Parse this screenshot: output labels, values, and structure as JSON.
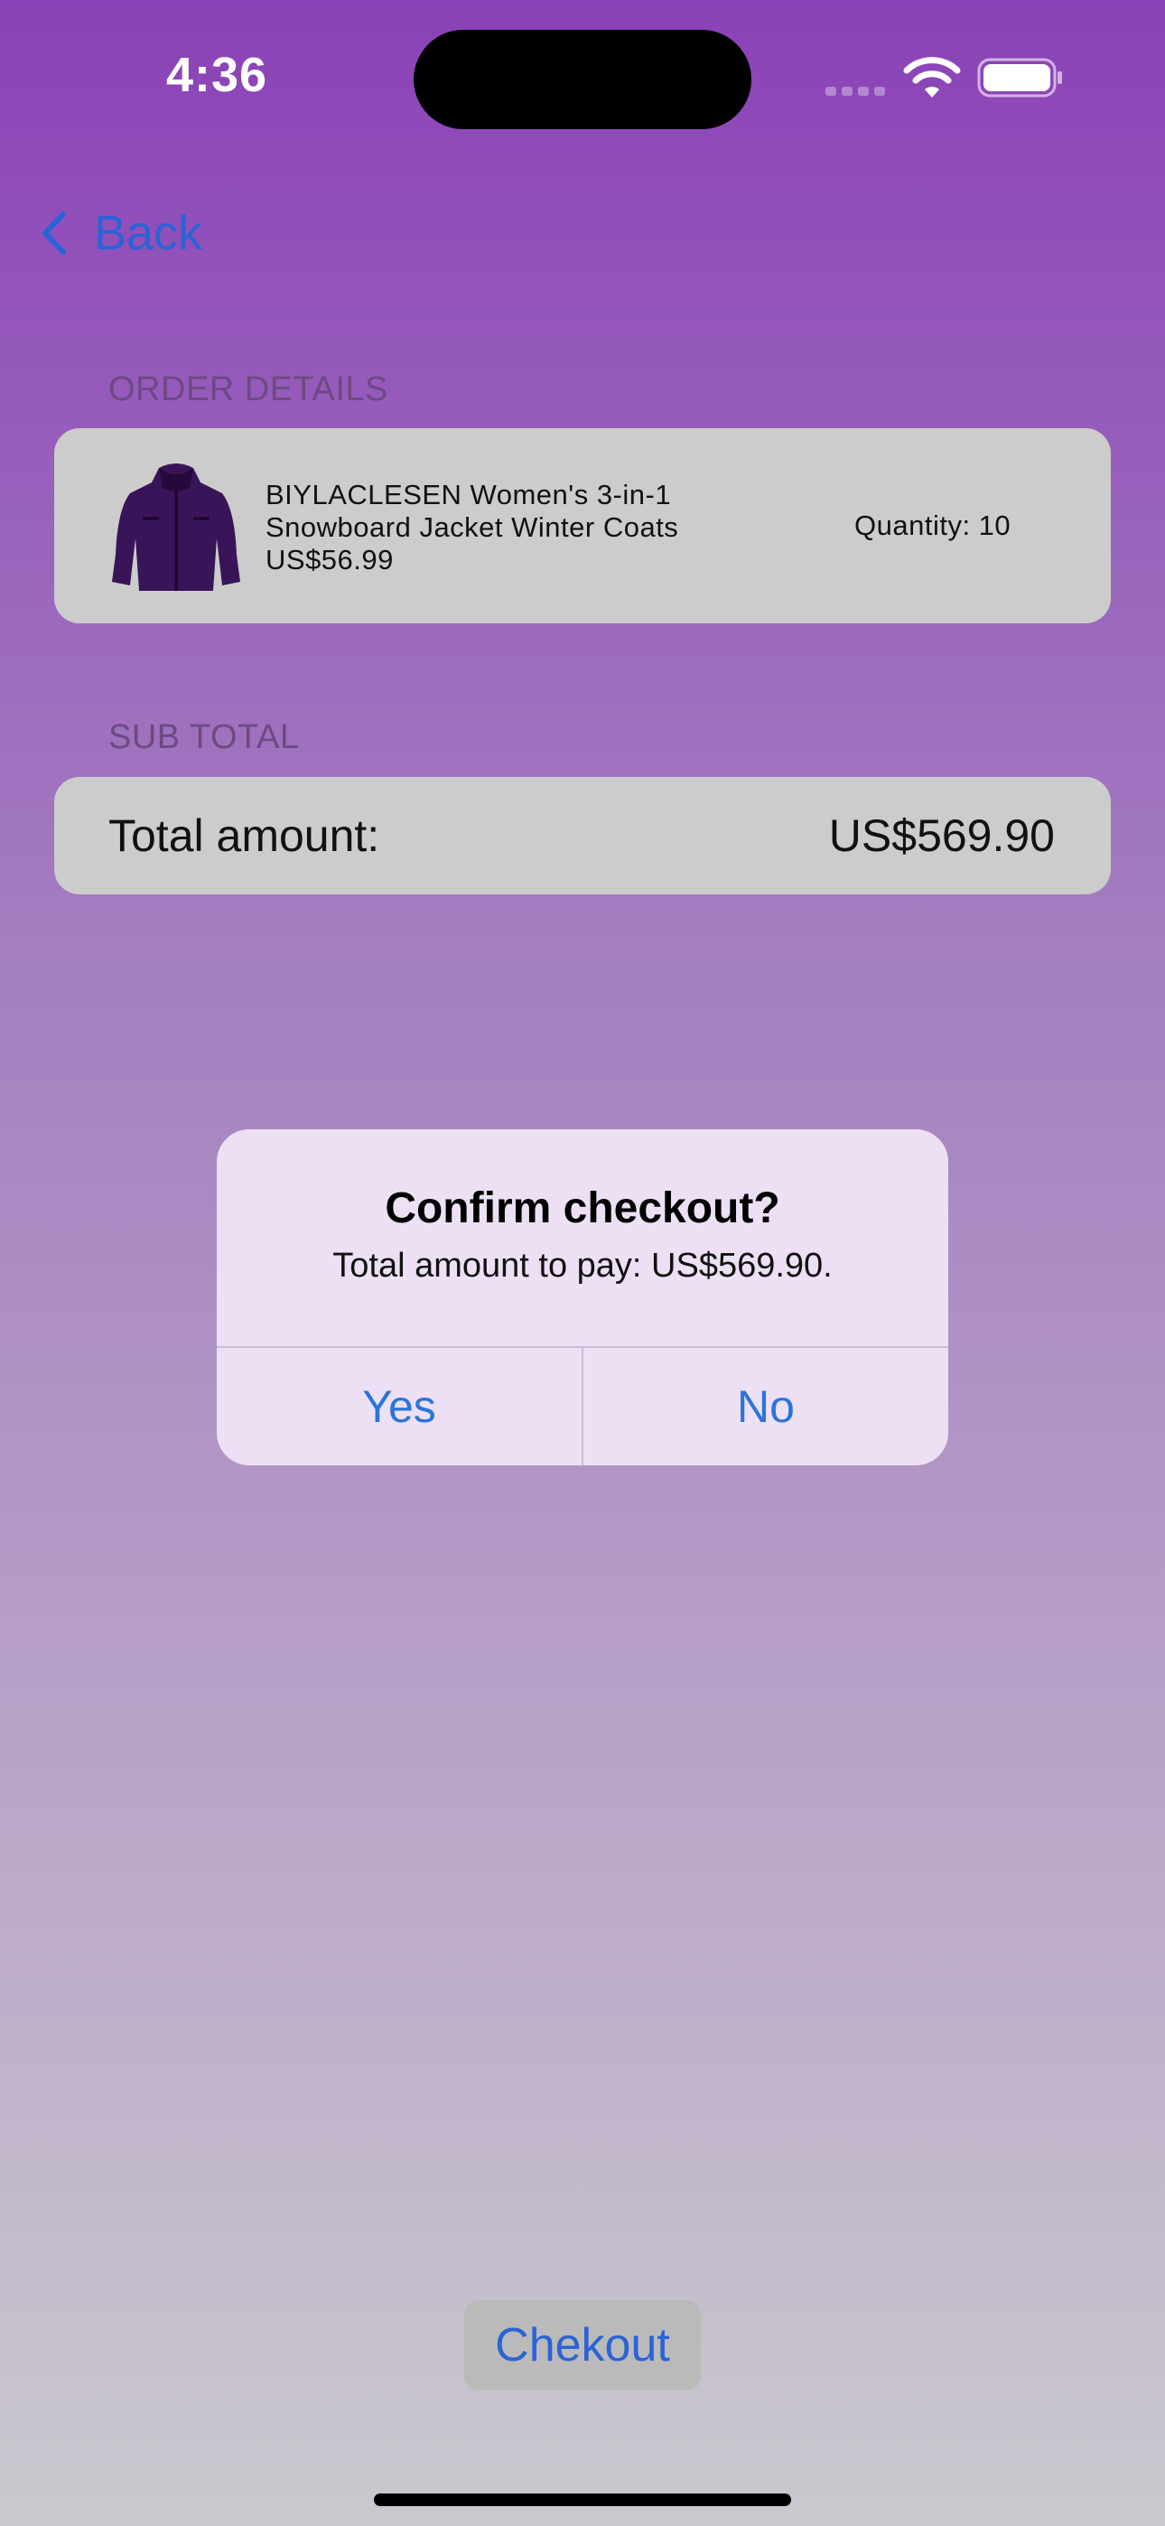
{
  "status_bar": {
    "time": "4:36"
  },
  "nav": {
    "back_label": "Back"
  },
  "order_details": {
    "header": "ORDER DETAILS",
    "product": {
      "name_line1": "BIYLACLESEN Women's 3-in-1",
      "name_line2": "Snowboard Jacket Winter Coats",
      "price": "US$56.99",
      "quantity": "Quantity: 10",
      "image_icon": "purple-jacket-image"
    }
  },
  "subtotal": {
    "header": "SUB TOTAL",
    "label": "Total amount:",
    "value": "US$569.90"
  },
  "alert": {
    "title": "Confirm checkout?",
    "message": "Total amount to pay: US$569.90.",
    "yes_label": "Yes",
    "no_label": "No"
  },
  "checkout": {
    "label": "Chekout"
  },
  "colors": {
    "accent": "#2a63d6",
    "background_top": "#8b41b7",
    "background_bottom": "#cac9ce",
    "card": "#cccccc",
    "alert_background": "#ede0f5"
  }
}
